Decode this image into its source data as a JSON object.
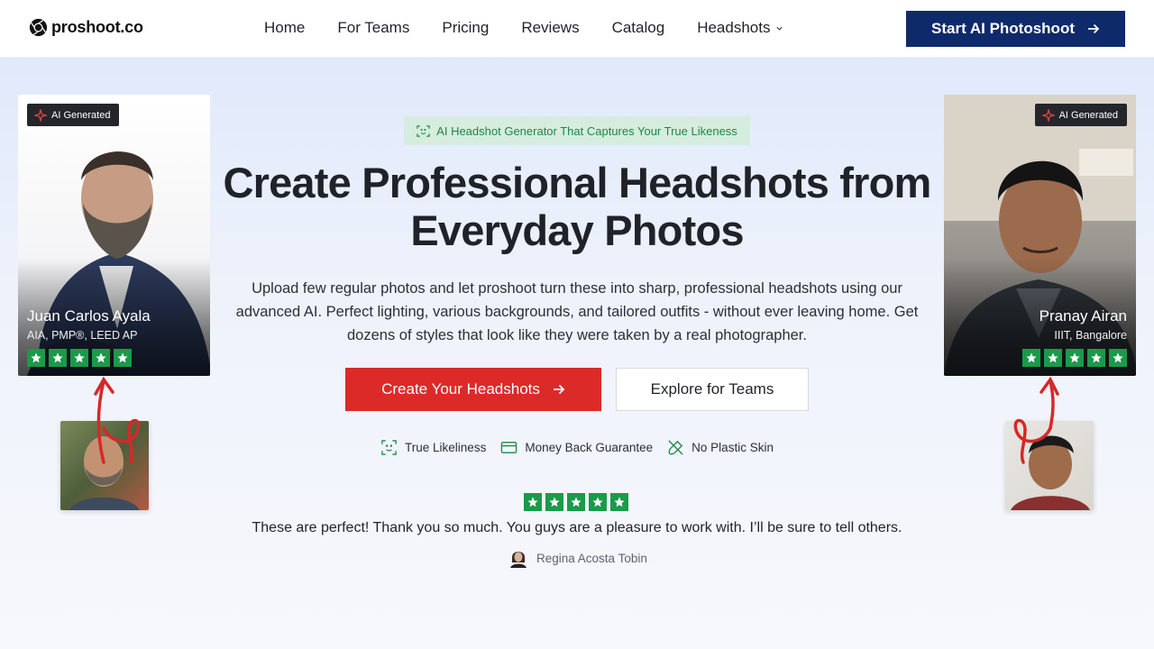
{
  "nav": {
    "logo_text": "proshoot.co",
    "links": [
      "Home",
      "For Teams",
      "Pricing",
      "Reviews",
      "Catalog",
      "Headshots"
    ],
    "cta_label": "Start AI Photoshoot"
  },
  "cards": {
    "left": {
      "badge": "AI Generated",
      "name": "Juan Carlos Ayala",
      "role": "AIA, PMP®, LEED AP",
      "rating": 5
    },
    "right": {
      "badge": "AI Generated",
      "name": "Pranay Airan",
      "role": "IIIT, Bangalore",
      "rating": 5
    }
  },
  "hero": {
    "tagline": "AI Headshot Generator That Captures Your True Likeness",
    "title_line1": "Create Professional Headshots from",
    "title_line2": "Everyday Photos",
    "subtitle": "Upload few regular photos and let proshoot turn these into sharp, professional headshots using our advanced AI. Perfect lighting, various backgrounds, and tailored outfits - without ever leaving home. Get dozens of styles that look like they were taken by a real photographer.",
    "primary_cta": "Create Your Headshots",
    "secondary_cta": "Explore for Teams"
  },
  "features": [
    {
      "label": "True Likeliness",
      "icon": "face-scan-icon"
    },
    {
      "label": "Money Back Guarantee",
      "icon": "credit-card-icon"
    },
    {
      "label": "No Plastic Skin",
      "icon": "no-brush-icon"
    }
  ],
  "review": {
    "rating": 5,
    "text": "These are perfect! Thank you so much. You guys are a pleasure to work with. I’ll be sure to tell others.",
    "author": "Regina Acosta Tobin"
  },
  "colors": {
    "brand_navy": "#0e2a6b",
    "primary_red": "#dc2a28",
    "star_green": "#1a9a4a",
    "tag_green": "#1c8a45"
  }
}
